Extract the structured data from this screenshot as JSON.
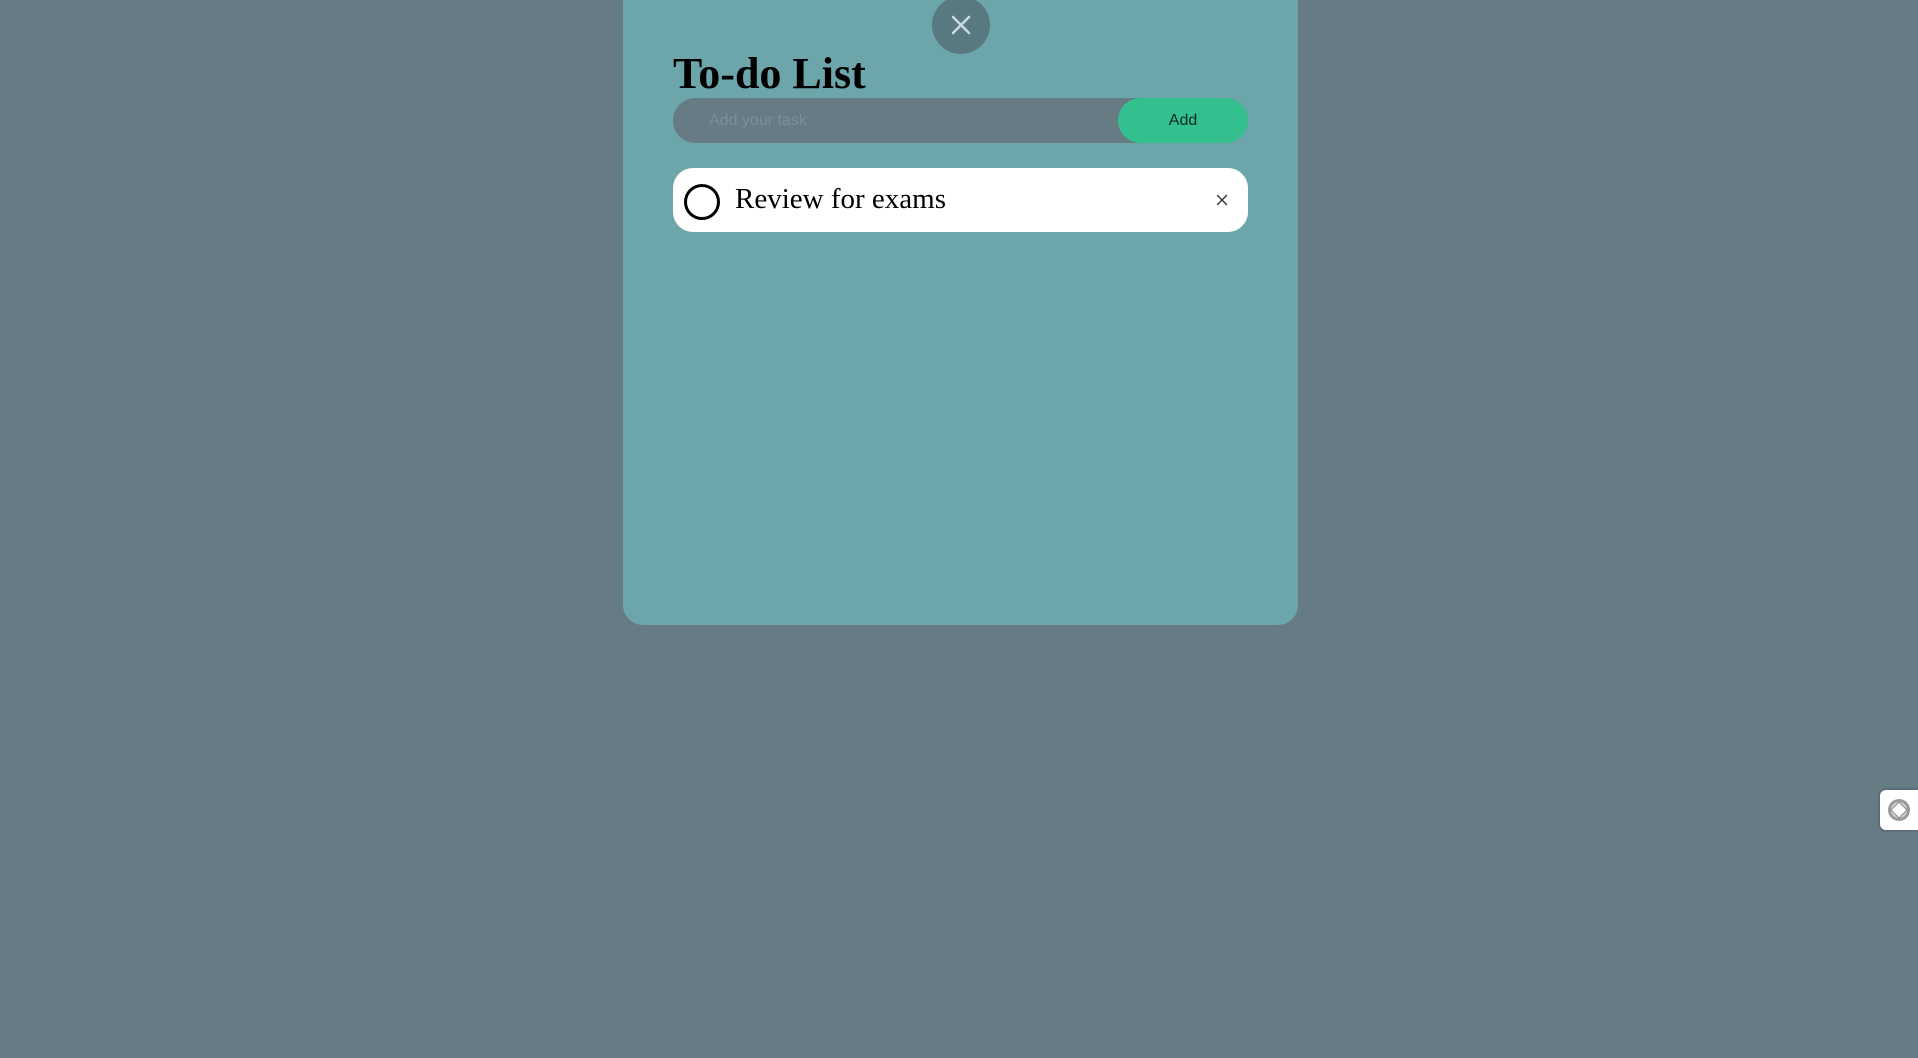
{
  "app": {
    "title": "To-do List"
  },
  "icons": {
    "close_app": "close-icon",
    "task_check": "circle-checkbox-icon",
    "task_delete": "close-icon",
    "side_widget": "extension-icon"
  },
  "add_form": {
    "input_value": "",
    "input_placeholder": "Add your task",
    "add_label": "Add"
  },
  "tasks": [
    {
      "label": "Review for exams",
      "done": false,
      "delete_label": "×"
    }
  ],
  "colors": {
    "page_background": "#667b84",
    "panel_background": "#6ca6ab",
    "close_button_background": "#587980",
    "accent_add_button": "#34bf8f",
    "task_card_background": "#ffffff"
  }
}
